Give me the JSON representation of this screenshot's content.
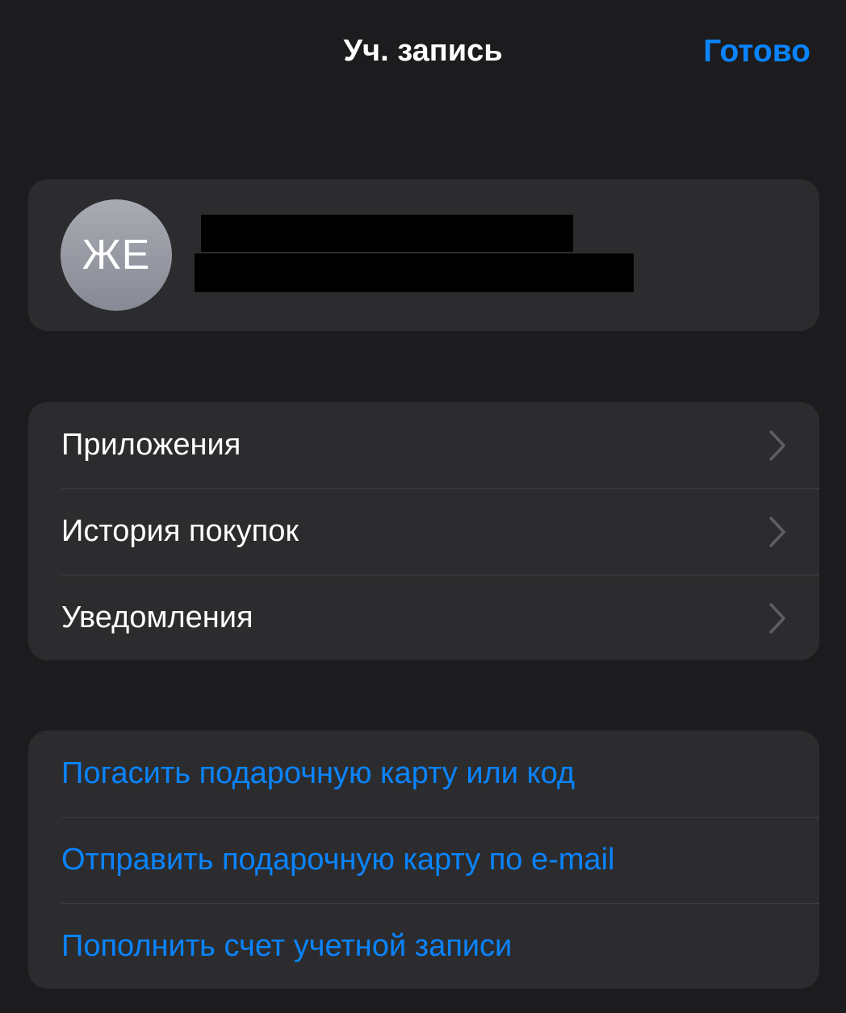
{
  "nav": {
    "title": "Уч. запись",
    "done_label": "Готово"
  },
  "profile": {
    "initials": "ЖЕ",
    "avatar_colors": [
      "#a9abb3",
      "#878994"
    ]
  },
  "menu": {
    "items": [
      {
        "label": "Приложения",
        "icon": "chevron-right-icon"
      },
      {
        "label": "История покупок",
        "icon": "chevron-right-icon"
      },
      {
        "label": "Уведомления",
        "icon": "chevron-right-icon"
      }
    ]
  },
  "actions": {
    "items": [
      {
        "label": "Погасить подарочную карту или код"
      },
      {
        "label": "Отправить подарочную карту по e-mail"
      },
      {
        "label": "Пополнить счет учетной записи"
      }
    ]
  },
  "colors": {
    "background": "#1c1c1e",
    "card": "#2c2c2e",
    "accent": "#0a84ff",
    "separator": "#3d3d41",
    "chevron": "#5e5e63"
  }
}
